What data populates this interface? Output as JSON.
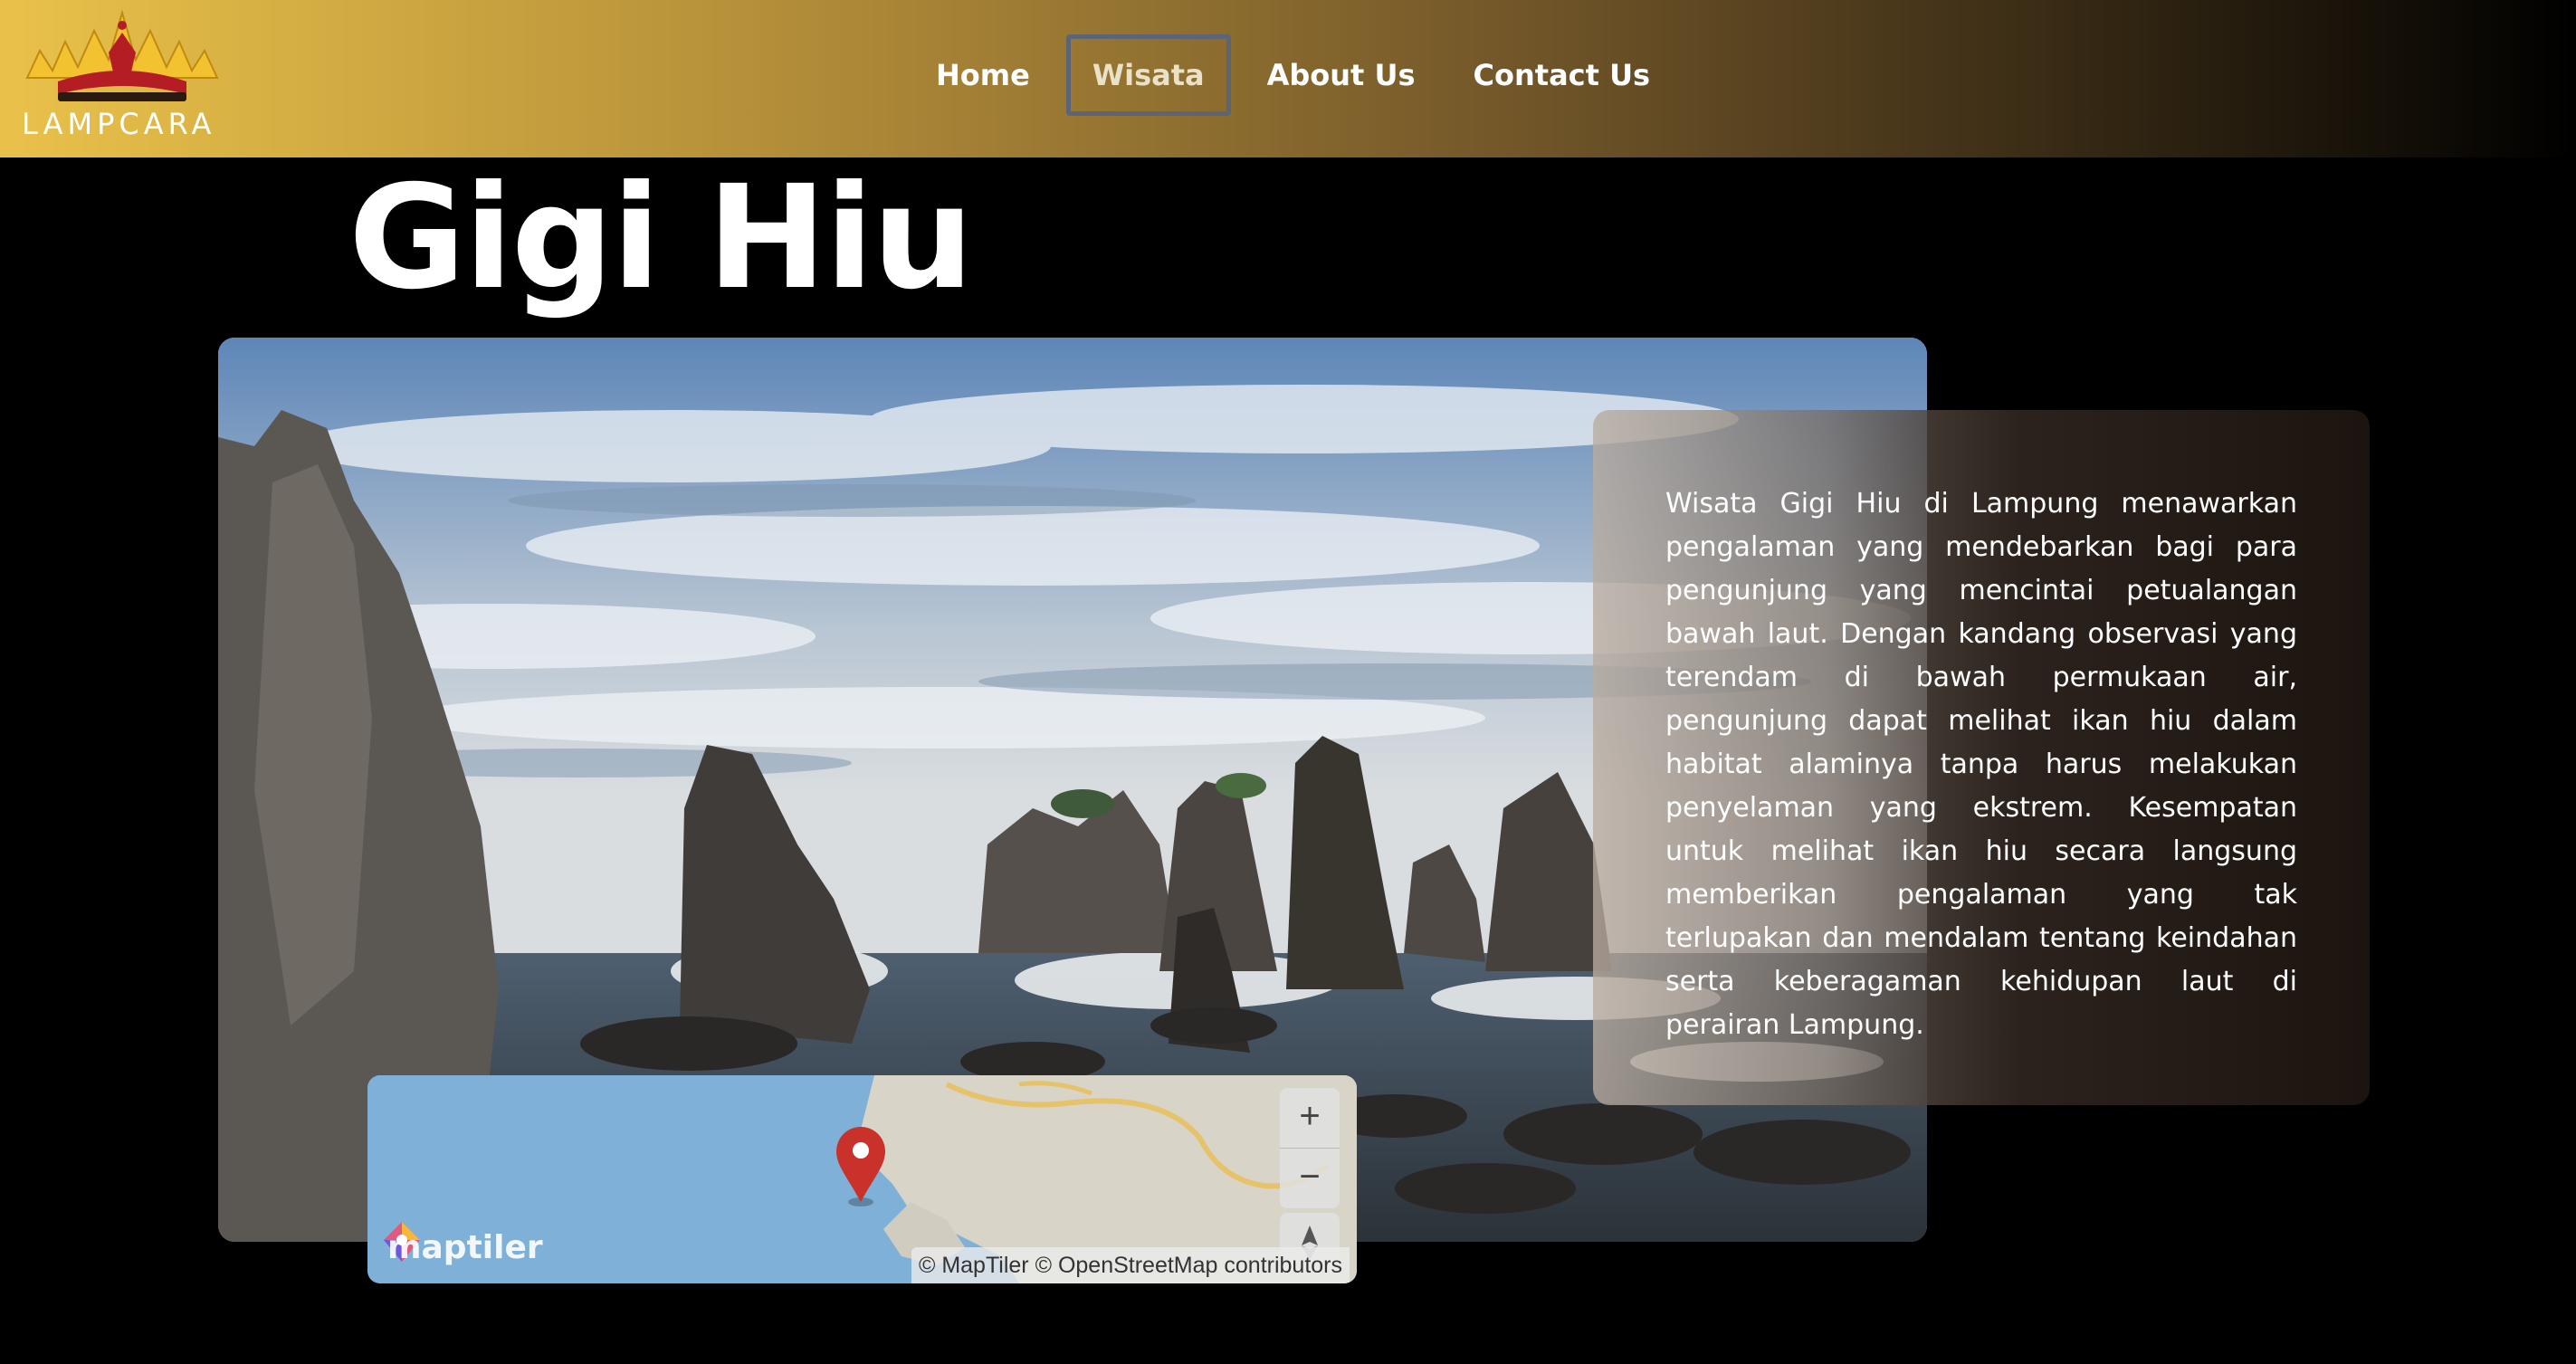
{
  "brand": {
    "name": "LAMPCARA",
    "logo_icon": "siger-crown-icon"
  },
  "nav": {
    "items": [
      {
        "label": "Home",
        "active": false
      },
      {
        "label": "Wisata",
        "active": true
      },
      {
        "label": "About Us",
        "active": false
      },
      {
        "label": "Contact Us",
        "active": false
      }
    ]
  },
  "page": {
    "title": "Gigi Hiu",
    "description": "Wisata Gigi Hiu di Lampung menawarkan pengalaman yang mendebarkan bagi para pengunjung yang mencintai petualangan bawah laut. Dengan kandang observasi yang terendam di bawah permukaan air, pengunjung dapat melihat ikan hiu dalam habitat alaminya tanpa harus melakukan penyelaman yang ekstrem. Kesempatan untuk melihat ikan hiu secara langsung memberikan pengalaman yang tak terlupakan dan mendalam tentang keindahan serta keberagaman kehidupan laut di perairan Lampung."
  },
  "map": {
    "zoom_in": "+",
    "zoom_out": "−",
    "compass_icon": "north-arrow-icon",
    "marker_icon": "map-pin-icon",
    "provider_logo_text": "maptiler",
    "attribution": "© MapTiler © OpenStreetMap contributors"
  },
  "colors": {
    "header_gold": "#e9c14a",
    "background": "#000000",
    "nav_active_border": "#5c6478",
    "marker_red": "#c8322a"
  }
}
